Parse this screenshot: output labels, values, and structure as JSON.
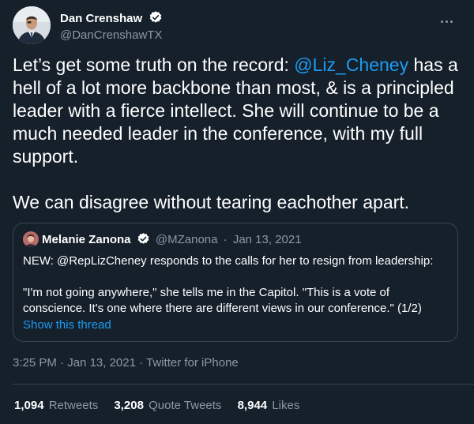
{
  "author": {
    "name": "Dan Crenshaw",
    "handle": "@DanCrenshawTX",
    "avatar_icon": "profile-photo",
    "verified_icon": "verified-badge-icon"
  },
  "tweet": {
    "text_before": "Let’s get some truth on the record: ",
    "mention": "@Liz_Cheney",
    "text_after": " has a hell of a lot more backbone than most, & is a principled leader with a fierce intellect. She will continue to be a much needed leader in the conference, with my full support.",
    "text_second": "We can disagree without tearing eachother apart."
  },
  "quote": {
    "name": "Melanie Zanona",
    "handle": "@MZanona",
    "separator": "·",
    "date": "Jan 13, 2021",
    "text": "NEW: @RepLizCheney responds to the calls for her to resign from leadership:\n\n\"I'm not going anywhere,\" she tells me in the Capitol. \"This is a vote of conscience. It's one where there are different views in our conference.\" (1/2)",
    "show_thread": "Show this thread"
  },
  "meta": {
    "time": "3:25 PM",
    "sep": "·",
    "date": "Jan 13, 2021",
    "source": "Twitter for iPhone"
  },
  "stats": {
    "retweets_count": "1,094",
    "retweets_label": "Retweets",
    "quotes_count": "3,208",
    "quotes_label": "Quote Tweets",
    "likes_count": "8,944",
    "likes_label": "Likes"
  },
  "colors": {
    "background": "#15202b",
    "accent": "#1d9bf0",
    "secondary_text": "#8b98a5",
    "border": "#38444d"
  }
}
